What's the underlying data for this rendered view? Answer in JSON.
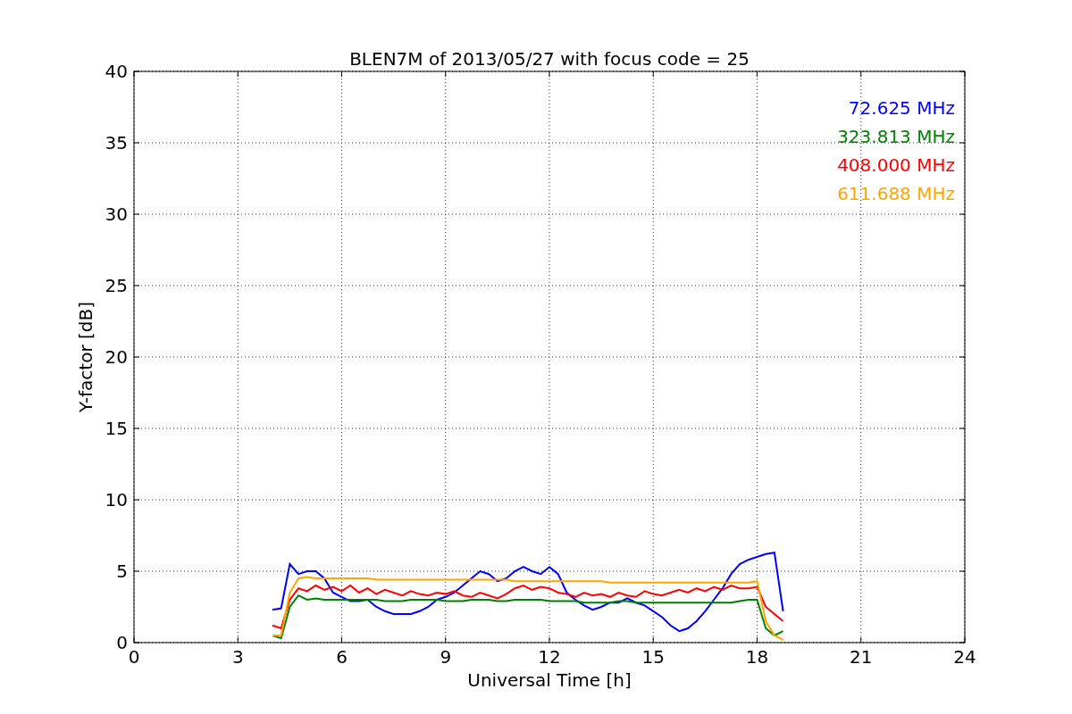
{
  "chart_data": {
    "type": "line",
    "title": "BLEN7M of 2013/05/27 with focus code = 25",
    "xlabel": "Universal Time [h]",
    "ylabel": "Y-factor [dB]",
    "x": [
      4,
      4.25,
      4.5,
      4.75,
      5,
      5.25,
      5.5,
      5.75,
      6,
      6.25,
      6.5,
      6.75,
      7,
      7.25,
      7.5,
      7.75,
      8,
      8.25,
      8.5,
      8.75,
      9,
      9.25,
      9.5,
      9.75,
      10,
      10.25,
      10.5,
      10.75,
      11,
      11.25,
      11.5,
      11.75,
      12,
      12.25,
      12.5,
      12.75,
      13,
      13.25,
      13.5,
      13.75,
      14,
      14.25,
      14.5,
      14.75,
      15,
      15.25,
      15.5,
      15.75,
      16,
      16.25,
      16.5,
      16.75,
      17,
      17.25,
      17.5,
      17.75,
      18,
      18.25,
      18.5,
      18.75
    ],
    "series": [
      {
        "name": "72.625 MHz",
        "color": "#0000ff",
        "values": [
          2.3,
          2.4,
          5.5,
          4.8,
          5.0,
          5.0,
          4.5,
          3.5,
          3.2,
          2.9,
          2.9,
          3.0,
          2.5,
          2.2,
          2.0,
          2.0,
          2.0,
          2.2,
          2.5,
          3.0,
          3.2,
          3.5,
          4.0,
          4.5,
          5.0,
          4.8,
          4.3,
          4.5,
          5.0,
          5.3,
          5.0,
          4.8,
          5.3,
          4.8,
          3.5,
          3.0,
          2.6,
          2.3,
          2.5,
          2.8,
          2.8,
          3.1,
          2.8,
          2.6,
          2.2,
          1.8,
          1.2,
          0.8,
          1.0,
          1.5,
          2.2,
          3.0,
          3.8,
          4.8,
          5.5,
          5.8,
          6.0,
          6.2,
          6.3,
          2.2
        ]
      },
      {
        "name": "323.813 MHz",
        "color": "#008000",
        "values": [
          0.5,
          0.3,
          2.5,
          3.3,
          3.0,
          3.1,
          3.0,
          3.0,
          3.0,
          3.0,
          3.0,
          3.0,
          3.0,
          2.9,
          2.9,
          2.9,
          3.0,
          3.0,
          3.0,
          3.0,
          2.9,
          2.9,
          2.9,
          3.0,
          3.0,
          3.0,
          2.9,
          2.9,
          3.0,
          3.0,
          3.0,
          3.0,
          2.9,
          2.9,
          2.9,
          2.9,
          2.8,
          2.8,
          2.8,
          2.8,
          2.9,
          2.9,
          2.8,
          2.8,
          2.8,
          2.8,
          2.8,
          2.8,
          2.8,
          2.8,
          2.8,
          2.8,
          2.8,
          2.8,
          2.9,
          3.0,
          3.0,
          1.0,
          0.5,
          0.8
        ]
      },
      {
        "name": "408.000 MHz",
        "color": "#ff0000",
        "values": [
          1.2,
          1.0,
          3.0,
          3.8,
          3.6,
          4.0,
          3.7,
          3.9,
          3.6,
          4.0,
          3.5,
          3.8,
          3.4,
          3.7,
          3.5,
          3.3,
          3.6,
          3.4,
          3.3,
          3.5,
          3.4,
          3.6,
          3.3,
          3.2,
          3.5,
          3.3,
          3.1,
          3.4,
          3.8,
          4.0,
          3.7,
          3.9,
          3.8,
          3.5,
          3.4,
          3.2,
          3.5,
          3.3,
          3.4,
          3.2,
          3.5,
          3.3,
          3.2,
          3.6,
          3.4,
          3.3,
          3.5,
          3.7,
          3.5,
          3.8,
          3.6,
          3.9,
          3.7,
          4.0,
          3.8,
          3.8,
          3.9,
          2.5,
          2.0,
          1.5
        ]
      },
      {
        "name": "611.688 MHz",
        "color": "#ffa500",
        "values": [
          0.5,
          0.5,
          3.5,
          4.5,
          4.6,
          4.5,
          4.5,
          4.5,
          4.5,
          4.5,
          4.5,
          4.5,
          4.4,
          4.4,
          4.4,
          4.4,
          4.4,
          4.4,
          4.4,
          4.4,
          4.4,
          4.4,
          4.4,
          4.4,
          4.4,
          4.4,
          4.4,
          4.4,
          4.3,
          4.3,
          4.3,
          4.3,
          4.3,
          4.3,
          4.3,
          4.3,
          4.3,
          4.3,
          4.3,
          4.2,
          4.2,
          4.2,
          4.2,
          4.2,
          4.2,
          4.2,
          4.2,
          4.2,
          4.2,
          4.2,
          4.2,
          4.2,
          4.2,
          4.2,
          4.2,
          4.2,
          4.3,
          1.5,
          0.5,
          0.2
        ]
      }
    ],
    "xlim": [
      0,
      24
    ],
    "ylim": [
      0,
      40
    ],
    "xticks": [
      0,
      3,
      6,
      9,
      12,
      15,
      18,
      21,
      24
    ],
    "yticks": [
      0,
      5,
      10,
      15,
      20,
      25,
      30,
      35,
      40
    ],
    "grid": true
  }
}
